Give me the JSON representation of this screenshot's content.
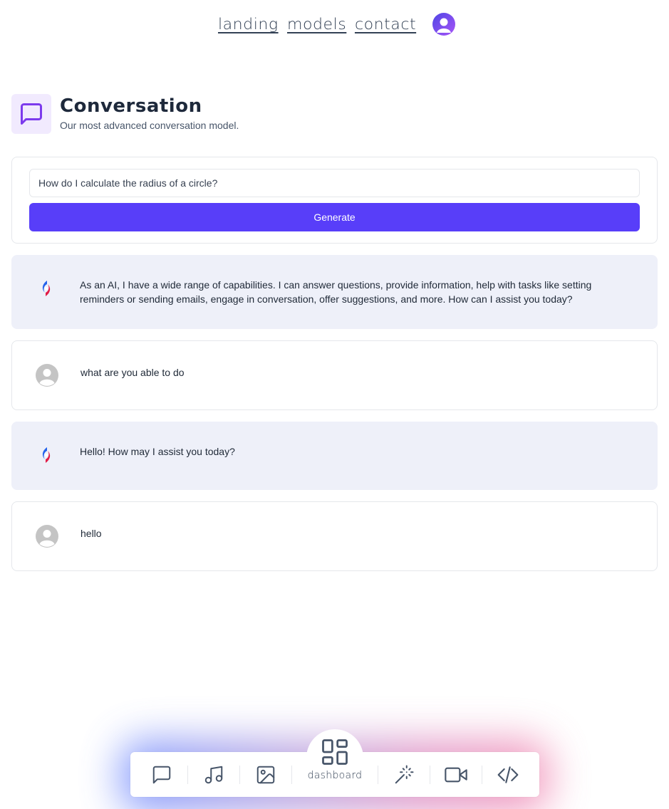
{
  "nav": {
    "links": [
      "landing",
      "models",
      "contact"
    ]
  },
  "header": {
    "title": "Conversation",
    "subtitle": "Our most advanced conversation model.",
    "icon": "message-square-icon",
    "accent": "#7c3aed"
  },
  "form": {
    "prompt_value": "How do I calculate the radius of a circle?",
    "generate_label": "Generate",
    "button_color": "#583ef9"
  },
  "messages": [
    {
      "role": "ai",
      "text": "As an AI, I have a wide range of capabilities. I can answer questions, provide information, help with tasks like setting reminders or sending emails, engage in conversation, offer suggestions, and more. How can I assist you today?"
    },
    {
      "role": "user",
      "text": "what are you able to do"
    },
    {
      "role": "ai",
      "text": "Hello! How may I assist you today?"
    },
    {
      "role": "user",
      "text": "hello"
    }
  ],
  "dock": {
    "items": [
      "message-square-icon",
      "music-icon",
      "image-icon",
      "dashboard-icon",
      "wand-icon",
      "video-icon",
      "code-icon"
    ],
    "center_label": "dashboard"
  }
}
